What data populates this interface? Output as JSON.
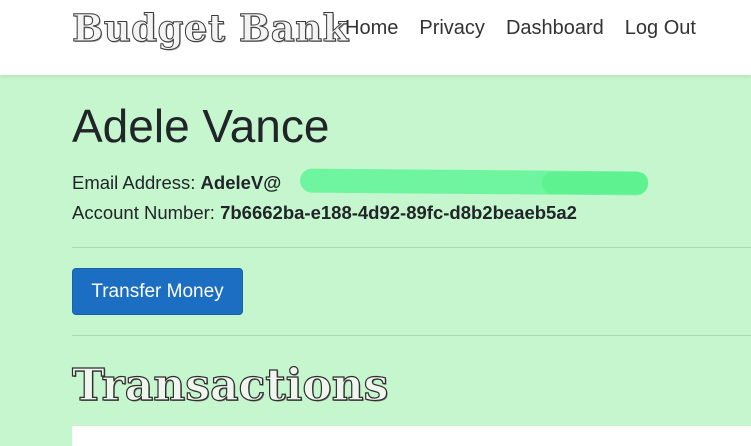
{
  "brand": {
    "name": "Budget Bank"
  },
  "nav": {
    "items": [
      {
        "label": "Home"
      },
      {
        "label": "Privacy"
      },
      {
        "label": "Dashboard"
      },
      {
        "label": "Log Out"
      }
    ]
  },
  "user": {
    "name": "Adele Vance",
    "email_label": "Email Address:",
    "email_value": "AdeleV@",
    "account_label": "Account Number:",
    "account_value": "7b6662ba-e188-4d92-89fc-d8b2beaeb5a2"
  },
  "actions": {
    "transfer_label": "Transfer Money"
  },
  "transactions": {
    "title": "Transactions"
  },
  "colors": {
    "background": "#c6f6cd",
    "primary_button": "#1b6ec2",
    "redaction": "#6ff5a0"
  }
}
